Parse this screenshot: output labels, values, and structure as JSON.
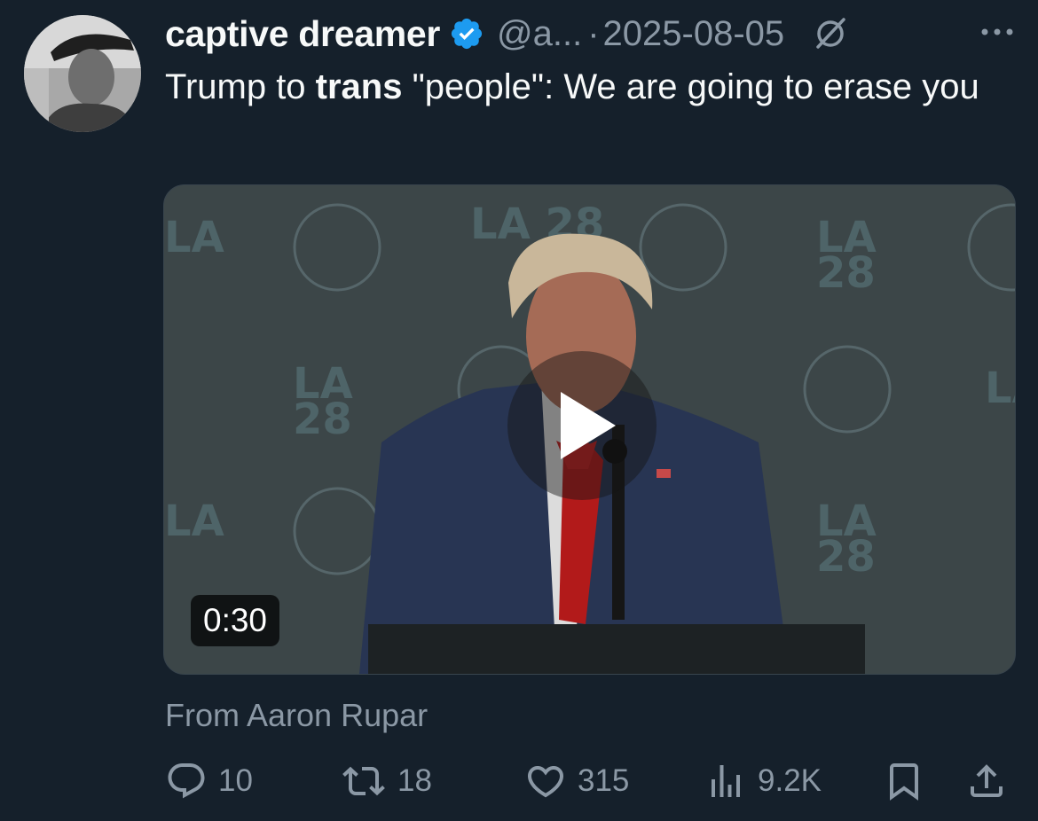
{
  "tweet": {
    "author_name": "captive dreamer",
    "handle": "@a...",
    "separator": "·",
    "date": "2025-08-05",
    "text_before": "Trump to ",
    "text_bold": "trans",
    "text_after": " \"people\": We are going to erase you",
    "attribution": "From Aaron Rupar",
    "video_duration": "0:30"
  },
  "actions": {
    "replies": "10",
    "reposts": "18",
    "likes": "315",
    "views": "9.2K"
  },
  "icons": {
    "verified": "verified-badge-icon",
    "grok": "grok-icon",
    "more": "more-icon",
    "reply": "reply-icon",
    "repost": "repost-icon",
    "like": "heart-icon",
    "views": "views-chart-icon",
    "bookmark": "bookmark-icon",
    "share": "share-icon",
    "play": "play-icon"
  },
  "colors": {
    "background": "#15202b",
    "text": "#f7f9f9",
    "muted": "#8b98a5",
    "verified": "#1d9bf0"
  },
  "video_overlay": {
    "backdrop_logo": "LA 28"
  }
}
